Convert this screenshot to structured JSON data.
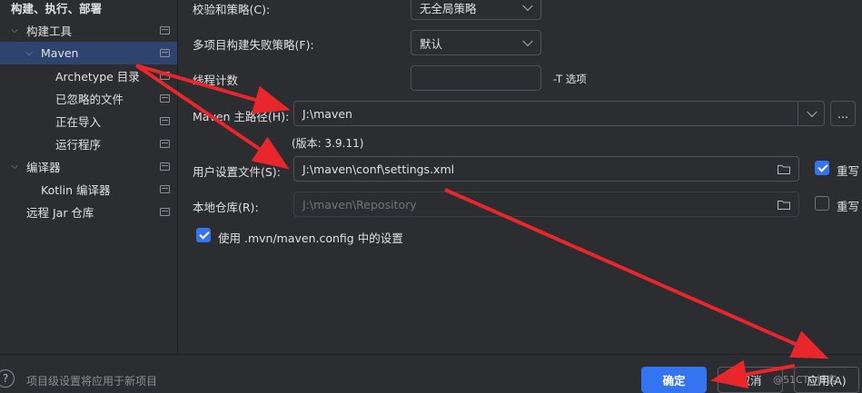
{
  "sidebar": {
    "items": [
      {
        "label": "构建、执行、部署",
        "bold": true,
        "expanded": true,
        "has_chevron": true
      },
      {
        "label": "构建工具",
        "expanded": true,
        "has_chevron": true,
        "has_icon": true
      },
      {
        "label": "Maven",
        "expanded": true,
        "has_chevron": true,
        "has_icon": true,
        "selected": true
      },
      {
        "label": "Archetype 目录",
        "has_icon": true
      },
      {
        "label": "已忽略的文件",
        "has_icon": true
      },
      {
        "label": "正在导入",
        "has_icon": true
      },
      {
        "label": "运行程序",
        "has_icon": true
      },
      {
        "label": "编译器",
        "expanded": true,
        "has_chevron": true,
        "has_icon": true
      },
      {
        "label": "Kotlin 编译器",
        "has_icon": true
      },
      {
        "label": "远程 Jar 仓库",
        "has_icon": true
      }
    ]
  },
  "form": {
    "checksum_label": "校验和策略(C):",
    "checksum_value": "无全局策略",
    "multiproject_label": "多项目构建失败策略(F):",
    "multiproject_value": "默认",
    "threads_label": "线程计数",
    "threads_value": "",
    "threads_hint": "-T 选项",
    "maven_home_label": "Maven 主路径(H):",
    "maven_home_value": "J:\\maven",
    "maven_home_more": "...",
    "version_text": "(版本: 3.9.11)",
    "user_settings_label": "用户设置文件(S):",
    "user_settings_value": "J:\\maven\\conf\\settings.xml",
    "user_settings_override_label": "重写",
    "user_settings_override_checked": true,
    "local_repo_label": "本地仓库(R):",
    "local_repo_value": "J:\\maven\\Repository",
    "local_repo_override_label": "重写",
    "local_repo_override_checked": false,
    "use_mvn_config_label": "使用 .mvn/maven.config 中的设置",
    "use_mvn_config_checked": true
  },
  "footer": {
    "help_icon": "?",
    "hint_text": "项目级设置将应用于新项目",
    "ok_label": "确定",
    "cancel_label": "取消",
    "apply_label": "应用(A)",
    "watermark": "@51CTO博客"
  },
  "colors": {
    "background": "#2b2d30",
    "selection": "#2e436e",
    "accent": "#3574f0",
    "annotation_arrow": "#e8262b"
  }
}
